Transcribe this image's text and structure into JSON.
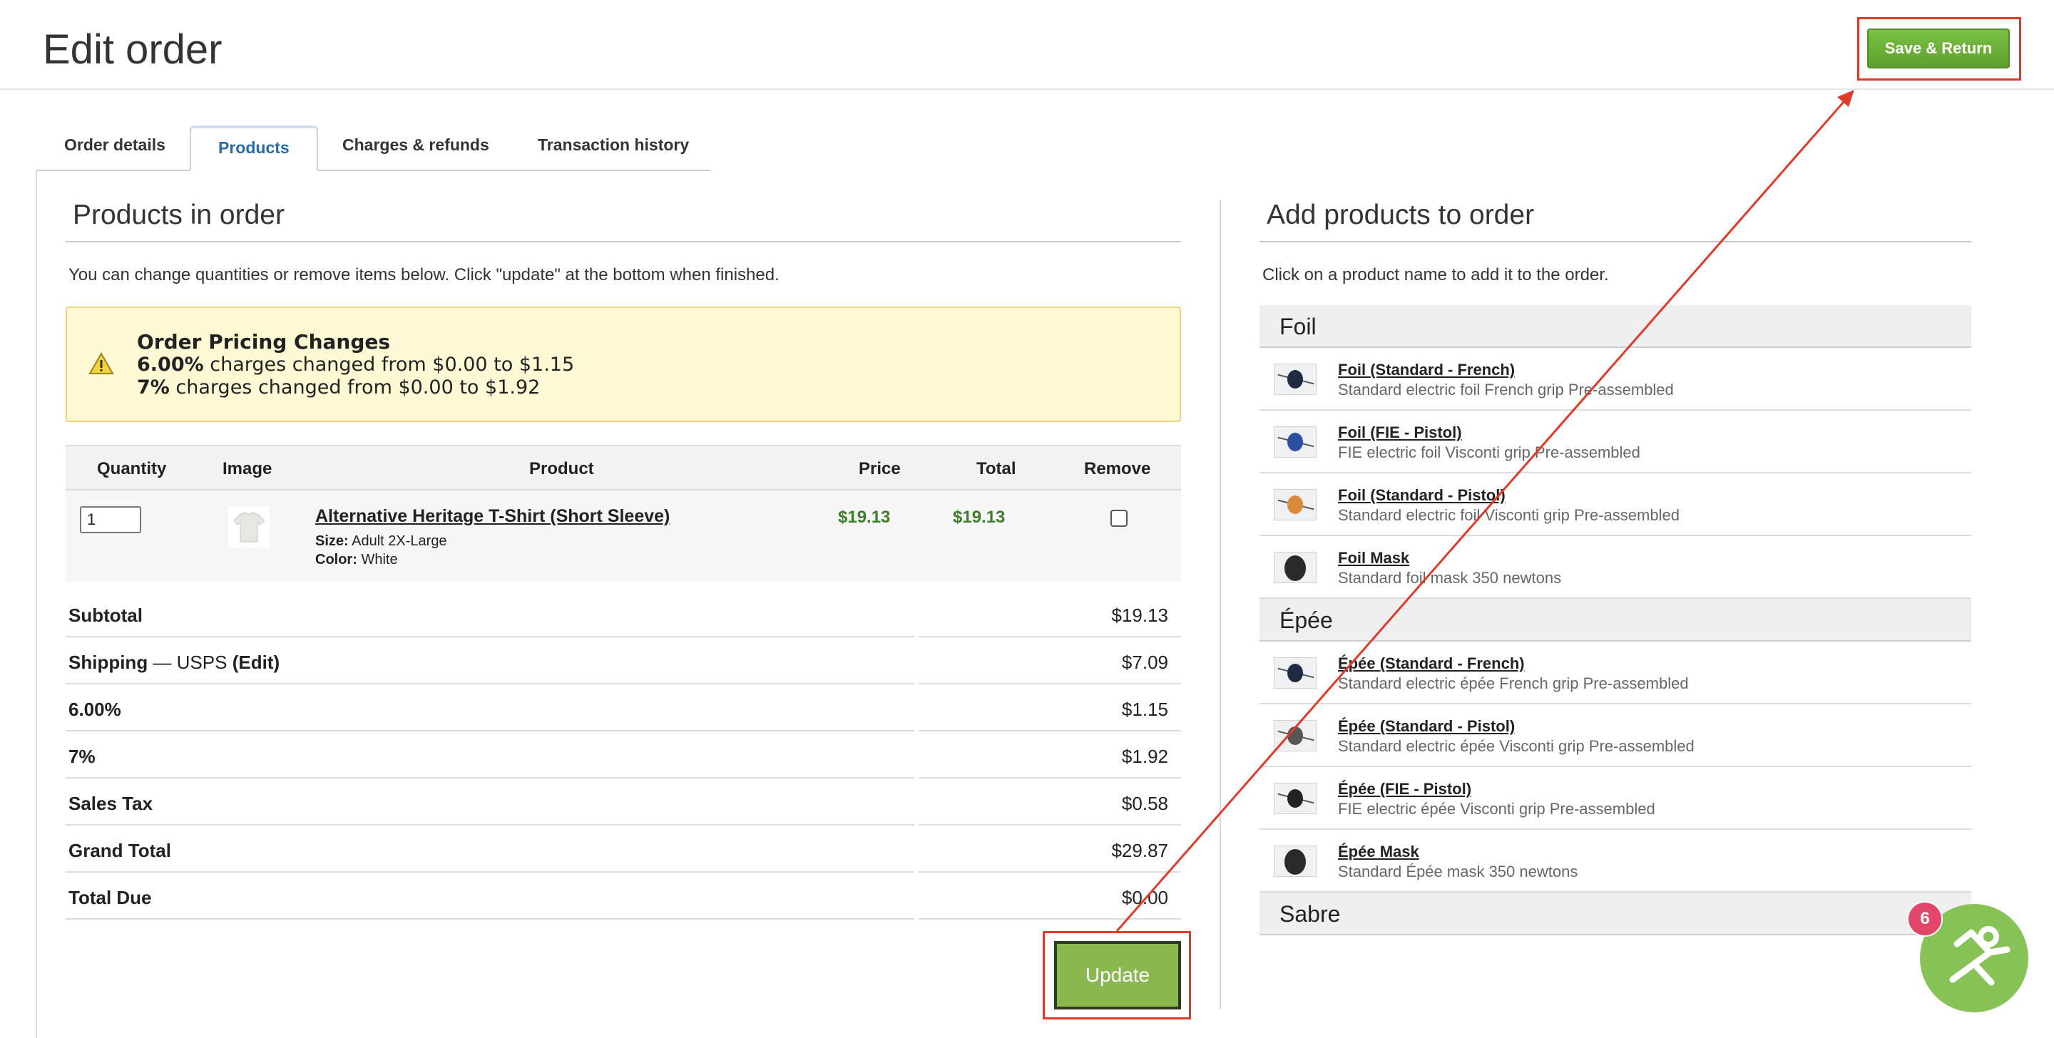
{
  "header": {
    "title": "Edit order",
    "save_label": "Save & Return"
  },
  "tabs": [
    "Order details",
    "Products",
    "Charges & refunds",
    "Transaction history"
  ],
  "left": {
    "title": "Products in order",
    "intro": "You can change quantities or remove items below. Click \"update\" at the bottom when finished.",
    "alert": {
      "title": "Order Pricing Changes",
      "line1_bold": "6.00%",
      "line1_rest": " charges changed from $0.00 to $1.15",
      "line2_bold": "7%",
      "line2_rest": " charges changed from $0.00 to $1.92"
    },
    "table": {
      "headers": [
        "Quantity",
        "Image",
        "Product",
        "Price",
        "Total",
        "Remove"
      ],
      "row": {
        "quantity": "1",
        "product": "Alternative Heritage T-Shirt (Short Sleeve)",
        "size_label": "Size:",
        "size": "Adult 2X-Large",
        "color_label": "Color:",
        "color": "White",
        "price": "$19.13",
        "total": "$19.13"
      }
    },
    "summary": [
      {
        "label": "Subtotal",
        "value": "$19.13"
      },
      {
        "label": "Shipping",
        "value": "$7.09"
      },
      {
        "label": "6.00%",
        "value": "$1.15"
      },
      {
        "label": "7%",
        "value": "$1.92"
      },
      {
        "label": "Sales Tax",
        "value": "$0.58"
      },
      {
        "label": "Grand Total",
        "value": "$29.87"
      },
      {
        "label": "Total Due",
        "value": "$0.00"
      }
    ],
    "shipping_sep": " — USPS ",
    "shipping_edit": "(Edit)",
    "update_label": "Update"
  },
  "right": {
    "title": "Add products to order",
    "intro": "Click on a product name to add it to the order.",
    "categories": [
      {
        "name": "Foil",
        "items": [
          {
            "name": "Foil (Standard - French)",
            "desc": "Standard electric foil French grip Pre-assembled"
          },
          {
            "name": "Foil (FIE - Pistol)",
            "desc": "FIE electric foil Visconti grip Pre-assembled"
          },
          {
            "name": "Foil (Standard - Pistol)",
            "desc": "Standard electric foil Visconti grip Pre-assembled"
          },
          {
            "name": "Foil Mask",
            "desc": "Standard foil mask 350 newtons"
          }
        ]
      },
      {
        "name": "Épée",
        "items": [
          {
            "name": "Épée (Standard - French)",
            "desc": "Standard electric épée French grip Pre-assembled"
          },
          {
            "name": "Épée (Standard - Pistol)",
            "desc": "Standard electric épée Visconti grip Pre-assembled"
          },
          {
            "name": "Épée (FIE - Pistol)",
            "desc": "FIE electric épée Visconti grip Pre-assembled"
          },
          {
            "name": "Épée Mask",
            "desc": "Standard Épée mask 350 newtons"
          }
        ]
      },
      {
        "name": "Sabre",
        "items": []
      }
    ]
  },
  "badge": {
    "count": "6",
    "icon": "running-person-icon"
  },
  "colors": {
    "accent_green": "#7ac143",
    "annotation_red": "#e03a2b",
    "price_green": "#3f7d2c",
    "alert_bg": "#fdf9d5"
  }
}
